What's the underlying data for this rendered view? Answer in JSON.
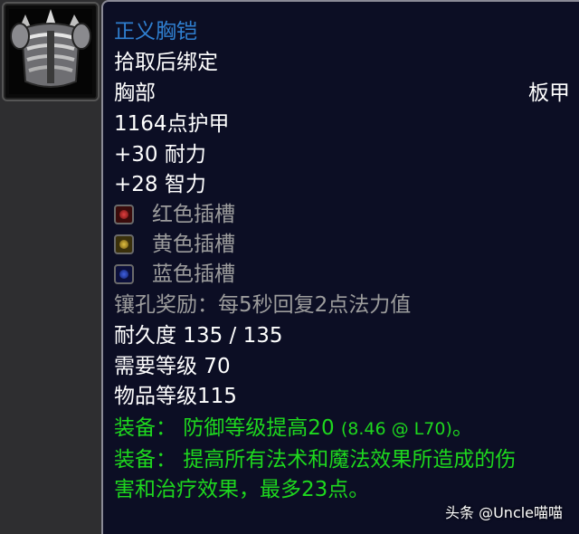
{
  "item": {
    "name": "正义胸铠",
    "bind": "拾取后绑定",
    "slot": "胸部",
    "armor_type": "板甲",
    "armor": "1164点护甲",
    "stats": [
      "+30 耐力",
      "+28 智力"
    ],
    "sockets": [
      {
        "label": "红色插槽",
        "color": "red"
      },
      {
        "label": "黄色插槽",
        "color": "yellow"
      },
      {
        "label": "蓝色插槽",
        "color": "blue"
      }
    ],
    "socket_bonus": "镶孔奖励：每5秒回复2点法力值",
    "durability": "耐久度 135 / 135",
    "required_level": "需要等级 70",
    "item_level": "物品等级115",
    "equip1_prefix": "装备：  防御等级提高20",
    "equip1_suffix": "(8.46 @ L70)",
    "equip1_end": "。",
    "equip2_line1": "装备：  提高所有法术和魔法效果所造成的伤",
    "equip2_line2": "害和治疗效果，最多23点。"
  },
  "icon": "plate-chest-armor-icon",
  "watermark": "头条 @Uncle喵喵",
  "colors": {
    "item_name": "#2f7fd0",
    "equip_green": "#1ed81e",
    "socket_gray": "#9d9d9d",
    "tooltip_bg": "#0c0e24"
  }
}
